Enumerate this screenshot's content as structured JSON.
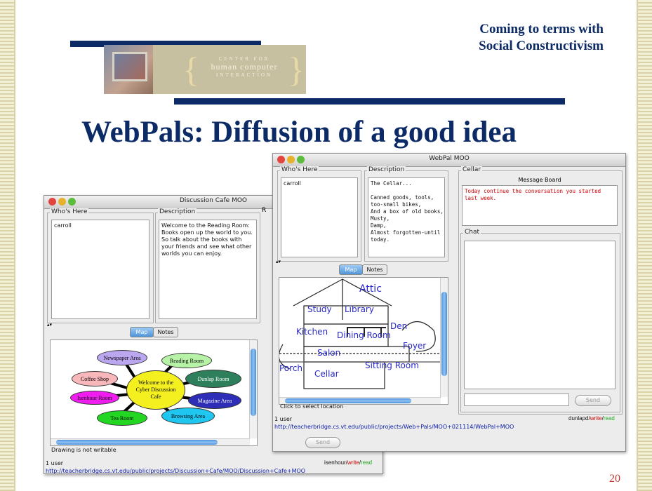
{
  "slide": {
    "subtitle_line1": "Coming to terms with",
    "subtitle_line2": "Social Constructivism",
    "title": "WebPals: Diffusion of a good idea",
    "page_number": "20",
    "logo": {
      "line1": "CENTER FOR",
      "line2": "human computer",
      "line3": "INTERACTION"
    }
  },
  "colors": {
    "title_navy": "#0b2a66",
    "page_number_red": "#c0392b",
    "url_blue": "#0a1aa6",
    "room_label_blue": "#2828c8",
    "message_red": "#cc0000"
  },
  "cafe_window": {
    "title": "Discussion Cafe MOO",
    "whos_here_label": "Who's Here",
    "whos_here_users": "carroll",
    "description_label": "Description",
    "description_text": "Welcome to the Reading Room: Books open up the world to you. So talk about the books with your friends and see what other worlds you can enjoy.",
    "side_label": "R",
    "tabs": [
      "Map",
      "Notes"
    ],
    "map_nodes": [
      "Newspaper Area",
      "Reading Room",
      "Coffee Shop",
      "Welcome to the Cyber Discussion Cafe",
      "Dunlap Room",
      "Isenhour Room",
      "Magazine Area",
      "Tea Room",
      "Browsing Area"
    ],
    "map_status": "Drawing is not writable",
    "user_count": "1 user",
    "url": "http://teacherbridge.cs.vt.edu/public/projects/Discussion+Cafe/MOO/Discussion+Cafe+MOO",
    "right_user": "isenhour",
    "write_label": "write",
    "read_label": "read"
  },
  "webpal_window": {
    "title": "WebPal MOO",
    "whos_here_label": "Who's Here",
    "whos_here_users": "carroll",
    "description_label": "Description",
    "description_text": "The Cellar...\n\nCanned goods, tools,\ntoo-small bikes,\nAnd a box of old books,\nMusty,\nDamp,\nAlmost forgotten-until\ntoday.",
    "tabs": [
      "Map",
      "Notes"
    ],
    "rooms": [
      "Attic",
      "Study",
      "Library",
      "Den",
      "Kitchen",
      "Dining Room",
      "Foyer",
      "Salon",
      "Porch",
      "Cellar",
      "Sitting Room"
    ],
    "map_status": "Click to select location",
    "cellar_label": "Cellar",
    "message_board_label": "Message Board",
    "message_text": "Today continue the conversation you started last week.",
    "chat_label": "Chat",
    "send_label": "Send",
    "user_count": "1 user",
    "url": "http://teacherbridge.cs.vt.edu/public/projects/Web+Pals/MOO+021114/WebPal+MOO",
    "right_user": "dunlapd",
    "write_label": "write",
    "read_label": "read"
  }
}
